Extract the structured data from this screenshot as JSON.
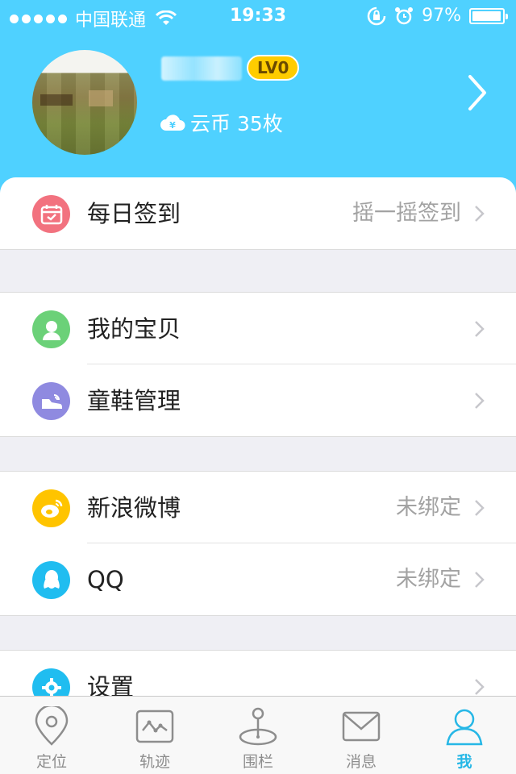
{
  "status_bar": {
    "carrier": "中国联通",
    "time": "19:33",
    "battery": "97%",
    "battery_level": 0.97
  },
  "profile": {
    "level_badge": "LV0",
    "coins_label": "云币 35枚"
  },
  "menu": {
    "checkin": {
      "label": "每日签到",
      "value": "摇一摇签到",
      "icon": "calendar-icon",
      "color": "#f2727f"
    },
    "my_baby": {
      "label": "我的宝贝",
      "icon": "person-icon",
      "color": "#6bd178"
    },
    "shoes": {
      "label": "童鞋管理",
      "icon": "shoe-icon",
      "color": "#8f8ae0"
    },
    "weibo": {
      "label": "新浪微博",
      "value": "未绑定",
      "icon": "weibo-icon",
      "color": "#ffc400"
    },
    "qq": {
      "label": "QQ",
      "value": "未绑定",
      "icon": "qq-penguin-icon",
      "color": "#20bdf0"
    },
    "settings": {
      "label": "设置",
      "icon": "gear-icon",
      "color": "#20bdf0"
    }
  },
  "tabs": [
    {
      "label": "定位",
      "icon": "location-pin-icon"
    },
    {
      "label": "轨迹",
      "icon": "track-chart-icon"
    },
    {
      "label": "围栏",
      "icon": "fence-pin-icon"
    },
    {
      "label": "消息",
      "icon": "envelope-icon"
    },
    {
      "label": "我",
      "icon": "user-icon",
      "active": true
    }
  ],
  "colors": {
    "header_bg": "#4fd1ff",
    "tab_active": "#26b7e6",
    "level_badge": "#ffcc00"
  }
}
